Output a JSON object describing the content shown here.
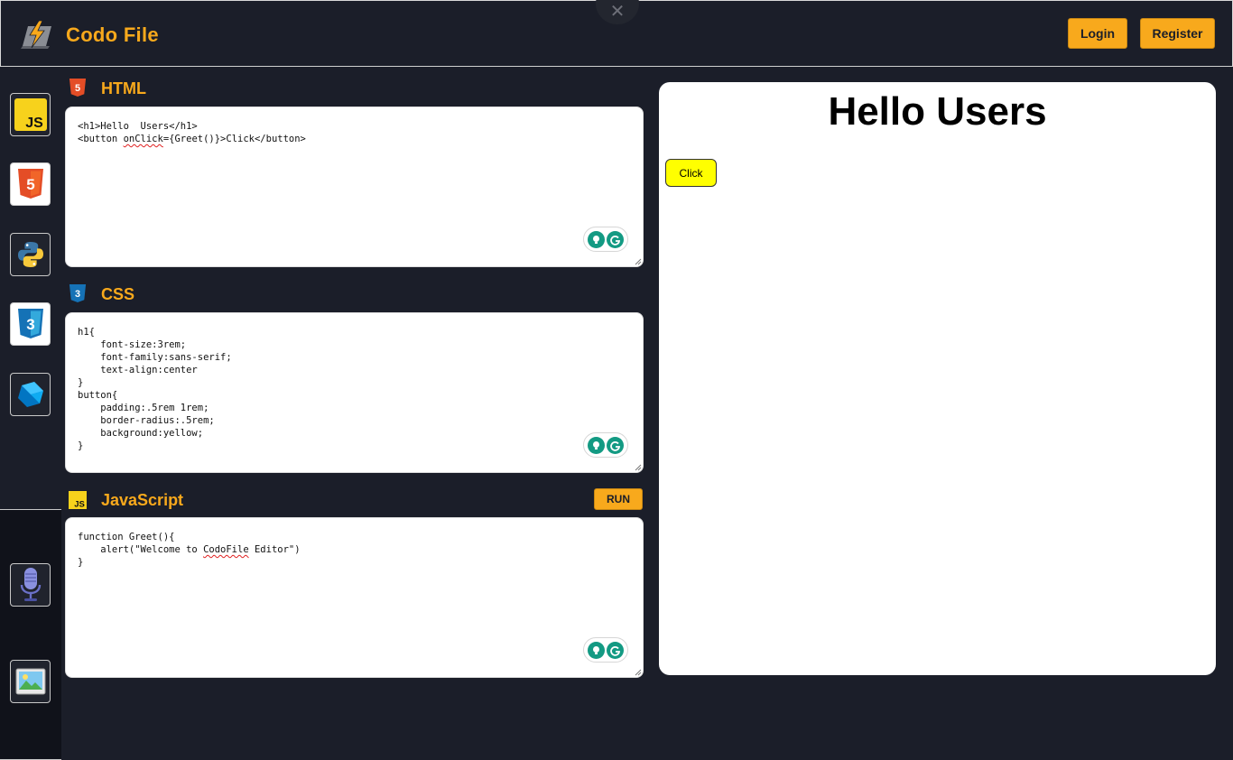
{
  "header": {
    "brand": "Codo File",
    "close_glyph": "✕",
    "login_label": "Login",
    "register_label": "Register",
    "accent_color": "#f8a91c"
  },
  "sidebar": {
    "items": [
      {
        "name": "js-icon",
        "label": "JS"
      },
      {
        "name": "html5-icon",
        "label": "5"
      },
      {
        "name": "python-icon"
      },
      {
        "name": "css3-icon",
        "label": "3"
      },
      {
        "name": "dart-icon"
      },
      {
        "name": "microphone-icon"
      },
      {
        "name": "image-icon"
      }
    ]
  },
  "sections": {
    "html": {
      "title": "HTML",
      "icon_label": "5",
      "code": [
        {
          "text": "<h1>Hello  Users</h1>"
        },
        {
          "pre": "<button ",
          "squiggle": "onClick",
          "post": "={Greet()}>Click</button>"
        }
      ]
    },
    "css": {
      "title": "CSS",
      "icon_label": "3",
      "code": "h1{\n    font-size:3rem;\n    font-family:sans-serif;\n    text-align:center\n}\nbutton{\n    padding:.5rem 1rem;\n    border-radius:.5rem;\n    background:yellow;\n}"
    },
    "js": {
      "title": "JavaScript",
      "icon_label": "JS",
      "run_label": "RUN",
      "code": [
        {
          "text": "function Greet(){"
        },
        {
          "pre": "    alert(\"Welcome to ",
          "squiggle": "CodoFile",
          "post": " Editor\")"
        },
        {
          "text": "}"
        }
      ]
    }
  },
  "preview": {
    "heading": "Hello Users",
    "button_label": "Click",
    "button_color": "#ffff00"
  }
}
